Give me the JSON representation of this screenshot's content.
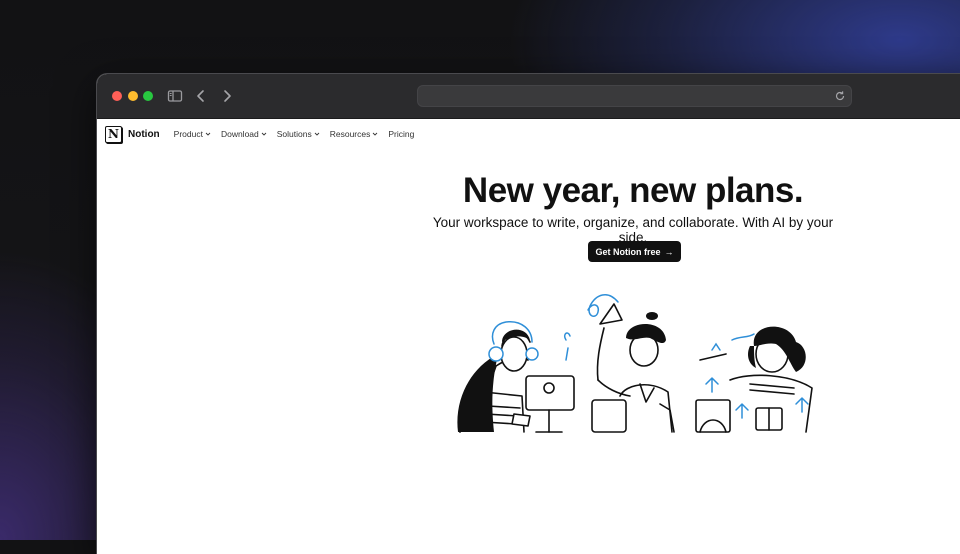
{
  "browser": {
    "controls": [
      "close",
      "minimize",
      "zoom"
    ],
    "icons": [
      "sidebar-icon",
      "back-icon",
      "forward-icon",
      "reload-icon"
    ],
    "url": ""
  },
  "nav": {
    "logo_letter": "N",
    "brand": "Notion",
    "items": [
      {
        "label": "Product",
        "has_dropdown": true
      },
      {
        "label": "Download",
        "has_dropdown": true
      },
      {
        "label": "Solutions",
        "has_dropdown": true
      },
      {
        "label": "Resources",
        "has_dropdown": true
      },
      {
        "label": "Pricing",
        "has_dropdown": false
      }
    ]
  },
  "hero": {
    "title": "New year, new plans.",
    "subtitle": "Your workspace to write, organize, and collaborate. With AI by your side.",
    "cta_label": "Get Notion free",
    "cta_arrow": "→"
  },
  "colors": {
    "accent_blue": "#2f8fd8",
    "ink": "#111111",
    "cta_bg": "#111111"
  }
}
